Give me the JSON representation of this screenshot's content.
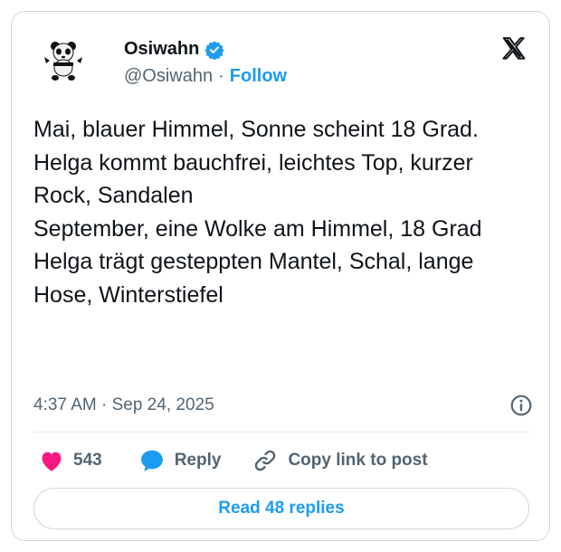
{
  "author": {
    "display_name": "Osiwahn",
    "handle": "@Osiwahn",
    "separator": "·",
    "follow_label": "Follow",
    "verified": true
  },
  "tweet": {
    "lines": [
      "Mai, blauer Himmel, Sonne scheint 18 Grad.",
      "Helga kommt bauchfrei, leichtes Top, kurzer Rock, Sandalen",
      "September, eine Wolke am Himmel, 18 Grad",
      "Helga trägt gesteppten Mantel, Schal, lange Hose, Winterstiefel"
    ],
    "timestamp": "4:37 AM · Sep 24, 2025"
  },
  "actions": {
    "like_count": "543",
    "reply_label": "Reply",
    "copy_label": "Copy link to post"
  },
  "replies_button": "Read 48 replies",
  "colors": {
    "accent": "#1d9bf0",
    "like": "#f91880",
    "text": "#0f1419",
    "secondary": "#536471",
    "border": "#cfd9de"
  },
  "icons": {
    "avatar": "panda-avatar",
    "verified": "verified-badge-icon",
    "brand": "x-logo-icon",
    "info": "info-icon",
    "like": "heart-icon",
    "reply": "speech-bubble-icon",
    "copy": "link-icon"
  }
}
